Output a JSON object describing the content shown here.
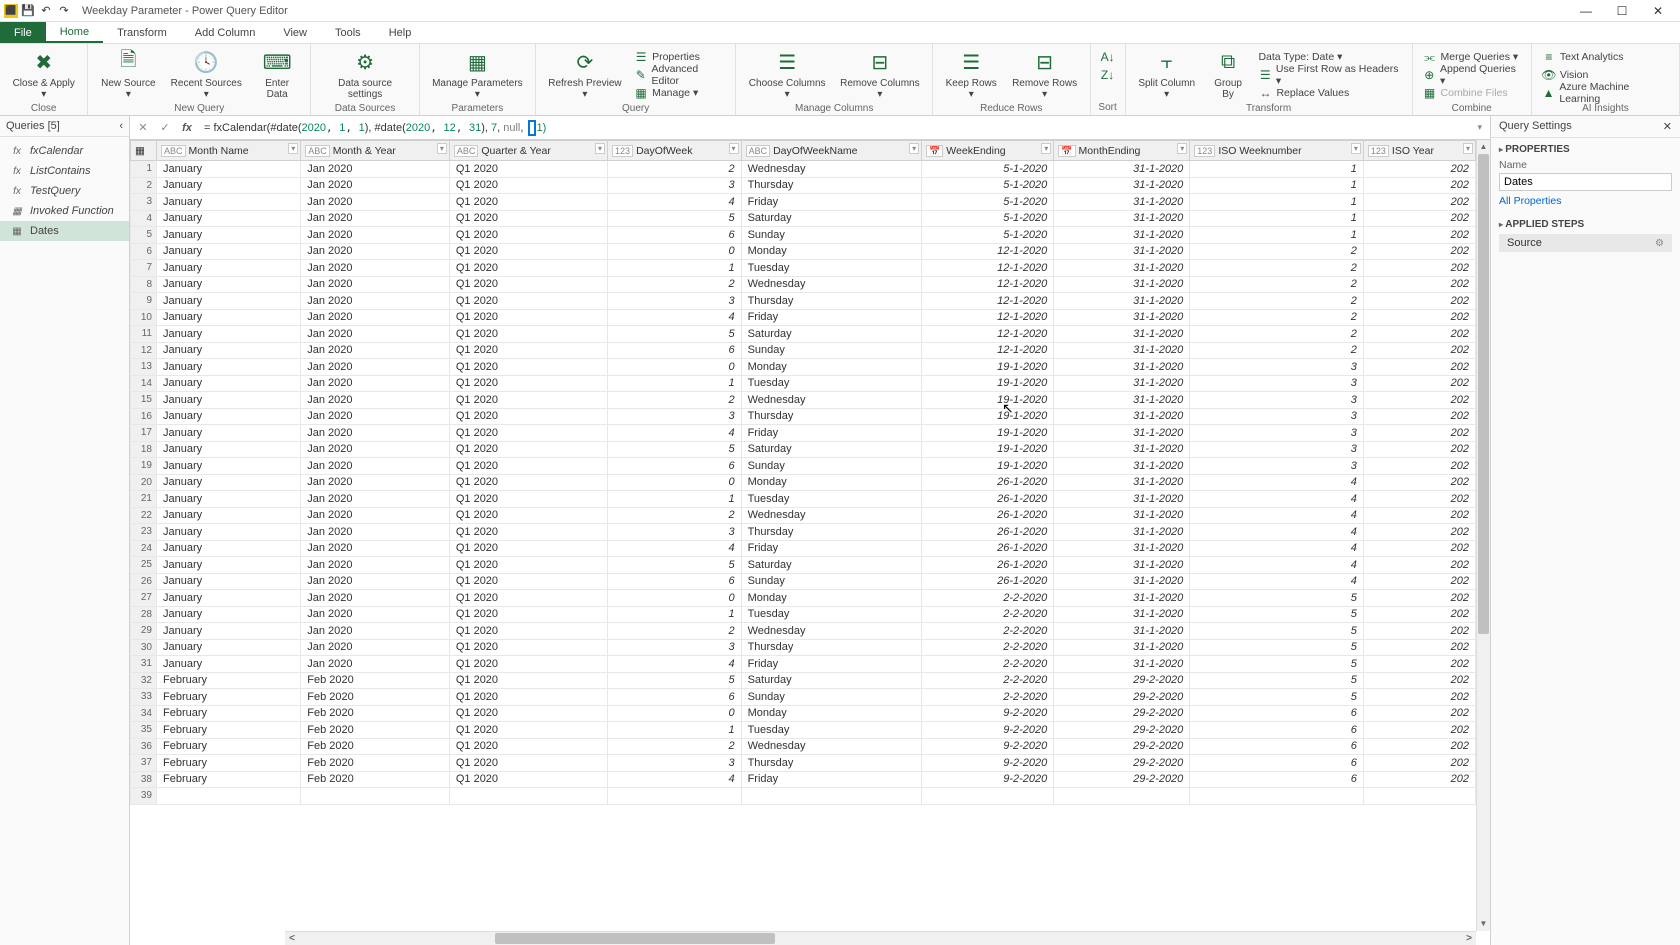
{
  "window": {
    "title": "Weekday Parameter - Power Query Editor",
    "minimize": "—",
    "maximize": "☐",
    "close": "✕"
  },
  "menutabs": {
    "file": "File",
    "home": "Home",
    "transform": "Transform",
    "addcolumn": "Add Column",
    "view": "View",
    "tools": "Tools",
    "help": "Help"
  },
  "ribbon": {
    "close_apply": "Close &\nApply ▾",
    "close_group": "Close",
    "new_source": "New\nSource ▾",
    "recent_sources": "Recent\nSources ▾",
    "enter_data": "Enter\nData",
    "new_query_group": "New Query",
    "data_source_settings": "Data source\nsettings",
    "data_sources_group": "Data Sources",
    "manage_parameters": "Manage\nParameters ▾",
    "parameters_group": "Parameters",
    "refresh_preview": "Refresh\nPreview ▾",
    "properties": "Properties",
    "advanced_editor": "Advanced Editor",
    "manage": "Manage ▾",
    "query_group": "Query",
    "choose_columns": "Choose\nColumns ▾",
    "remove_columns": "Remove\nColumns ▾",
    "manage_columns_group": "Manage Columns",
    "keep_rows": "Keep\nRows ▾",
    "remove_rows": "Remove\nRows ▾",
    "reduce_rows_group": "Reduce Rows",
    "sort_group": "Sort",
    "split_column": "Split\nColumn ▾",
    "group_by": "Group\nBy",
    "data_type": "Data Type: Date ▾",
    "first_row_headers": "Use First Row as Headers ▾",
    "replace_values": "Replace Values",
    "transform_group": "Transform",
    "merge_queries": "Merge Queries ▾",
    "append_queries": "Append Queries ▾",
    "combine_files": "Combine Files",
    "combine_group": "Combine",
    "text_analytics": "Text Analytics",
    "vision": "Vision",
    "azure_ml": "Azure Machine Learning",
    "ai_insights_group": "AI Insights"
  },
  "queries": {
    "header": "Queries [5]",
    "collapse": "‹",
    "items": [
      {
        "name": "fxCalendar",
        "icon": "fx"
      },
      {
        "name": "ListContains",
        "icon": "fx"
      },
      {
        "name": "TestQuery",
        "icon": "fx"
      },
      {
        "name": "Invoked Function",
        "icon": "▦"
      },
      {
        "name": "Dates",
        "icon": "▦"
      }
    ]
  },
  "formula": {
    "prefix": "= fxCalendar(#date(",
    "d1a": "2020",
    "d1b": "1",
    "d1c": "1",
    "mid1": "), #date(",
    "d2a": "2020",
    "d2b": "12",
    "d2c": "31",
    "mid2": "), ",
    "arg3": "7",
    "mid3": ", ",
    "arg4": "null",
    "mid4": ", ",
    "arg5a": " ",
    "arg5b": "1)",
    "fx_label": "fx"
  },
  "columns": [
    {
      "name": "Month Name",
      "type": "ABC"
    },
    {
      "name": "Month & Year",
      "type": "ABC"
    },
    {
      "name": "Quarter & Year",
      "type": "ABC"
    },
    {
      "name": "DayOfWeek",
      "type": "123"
    },
    {
      "name": "DayOfWeekName",
      "type": "ABC"
    },
    {
      "name": "WeekEnding",
      "type": "📅"
    },
    {
      "name": "MonthEnding",
      "type": "📅"
    },
    {
      "name": "ISO Weeknumber",
      "type": "123"
    },
    {
      "name": "ISO Year",
      "type": "123"
    }
  ],
  "rows": [
    {
      "n": 1,
      "mn": "January",
      "my": "Jan 2020",
      "qy": "Q1 2020",
      "dow": 2,
      "down": "Wednesday",
      "we": "5-1-2020",
      "me": "31-1-2020",
      "iw": 1,
      "iy": "202"
    },
    {
      "n": 2,
      "mn": "January",
      "my": "Jan 2020",
      "qy": "Q1 2020",
      "dow": 3,
      "down": "Thursday",
      "we": "5-1-2020",
      "me": "31-1-2020",
      "iw": 1,
      "iy": "202"
    },
    {
      "n": 3,
      "mn": "January",
      "my": "Jan 2020",
      "qy": "Q1 2020",
      "dow": 4,
      "down": "Friday",
      "we": "5-1-2020",
      "me": "31-1-2020",
      "iw": 1,
      "iy": "202"
    },
    {
      "n": 4,
      "mn": "January",
      "my": "Jan 2020",
      "qy": "Q1 2020",
      "dow": 5,
      "down": "Saturday",
      "we": "5-1-2020",
      "me": "31-1-2020",
      "iw": 1,
      "iy": "202"
    },
    {
      "n": 5,
      "mn": "January",
      "my": "Jan 2020",
      "qy": "Q1 2020",
      "dow": 6,
      "down": "Sunday",
      "we": "5-1-2020",
      "me": "31-1-2020",
      "iw": 1,
      "iy": "202"
    },
    {
      "n": 6,
      "mn": "January",
      "my": "Jan 2020",
      "qy": "Q1 2020",
      "dow": 0,
      "down": "Monday",
      "we": "12-1-2020",
      "me": "31-1-2020",
      "iw": 2,
      "iy": "202"
    },
    {
      "n": 7,
      "mn": "January",
      "my": "Jan 2020",
      "qy": "Q1 2020",
      "dow": 1,
      "down": "Tuesday",
      "we": "12-1-2020",
      "me": "31-1-2020",
      "iw": 2,
      "iy": "202"
    },
    {
      "n": 8,
      "mn": "January",
      "my": "Jan 2020",
      "qy": "Q1 2020",
      "dow": 2,
      "down": "Wednesday",
      "we": "12-1-2020",
      "me": "31-1-2020",
      "iw": 2,
      "iy": "202"
    },
    {
      "n": 9,
      "mn": "January",
      "my": "Jan 2020",
      "qy": "Q1 2020",
      "dow": 3,
      "down": "Thursday",
      "we": "12-1-2020",
      "me": "31-1-2020",
      "iw": 2,
      "iy": "202"
    },
    {
      "n": 10,
      "mn": "January",
      "my": "Jan 2020",
      "qy": "Q1 2020",
      "dow": 4,
      "down": "Friday",
      "we": "12-1-2020",
      "me": "31-1-2020",
      "iw": 2,
      "iy": "202"
    },
    {
      "n": 11,
      "mn": "January",
      "my": "Jan 2020",
      "qy": "Q1 2020",
      "dow": 5,
      "down": "Saturday",
      "we": "12-1-2020",
      "me": "31-1-2020",
      "iw": 2,
      "iy": "202"
    },
    {
      "n": 12,
      "mn": "January",
      "my": "Jan 2020",
      "qy": "Q1 2020",
      "dow": 6,
      "down": "Sunday",
      "we": "12-1-2020",
      "me": "31-1-2020",
      "iw": 2,
      "iy": "202"
    },
    {
      "n": 13,
      "mn": "January",
      "my": "Jan 2020",
      "qy": "Q1 2020",
      "dow": 0,
      "down": "Monday",
      "we": "19-1-2020",
      "me": "31-1-2020",
      "iw": 3,
      "iy": "202"
    },
    {
      "n": 14,
      "mn": "January",
      "my": "Jan 2020",
      "qy": "Q1 2020",
      "dow": 1,
      "down": "Tuesday",
      "we": "19-1-2020",
      "me": "31-1-2020",
      "iw": 3,
      "iy": "202"
    },
    {
      "n": 15,
      "mn": "January",
      "my": "Jan 2020",
      "qy": "Q1 2020",
      "dow": 2,
      "down": "Wednesday",
      "we": "19-1-2020",
      "me": "31-1-2020",
      "iw": 3,
      "iy": "202"
    },
    {
      "n": 16,
      "mn": "January",
      "my": "Jan 2020",
      "qy": "Q1 2020",
      "dow": 3,
      "down": "Thursday",
      "we": "19-1-2020",
      "me": "31-1-2020",
      "iw": 3,
      "iy": "202"
    },
    {
      "n": 17,
      "mn": "January",
      "my": "Jan 2020",
      "qy": "Q1 2020",
      "dow": 4,
      "down": "Friday",
      "we": "19-1-2020",
      "me": "31-1-2020",
      "iw": 3,
      "iy": "202"
    },
    {
      "n": 18,
      "mn": "January",
      "my": "Jan 2020",
      "qy": "Q1 2020",
      "dow": 5,
      "down": "Saturday",
      "we": "19-1-2020",
      "me": "31-1-2020",
      "iw": 3,
      "iy": "202"
    },
    {
      "n": 19,
      "mn": "January",
      "my": "Jan 2020",
      "qy": "Q1 2020",
      "dow": 6,
      "down": "Sunday",
      "we": "19-1-2020",
      "me": "31-1-2020",
      "iw": 3,
      "iy": "202"
    },
    {
      "n": 20,
      "mn": "January",
      "my": "Jan 2020",
      "qy": "Q1 2020",
      "dow": 0,
      "down": "Monday",
      "we": "26-1-2020",
      "me": "31-1-2020",
      "iw": 4,
      "iy": "202"
    },
    {
      "n": 21,
      "mn": "January",
      "my": "Jan 2020",
      "qy": "Q1 2020",
      "dow": 1,
      "down": "Tuesday",
      "we": "26-1-2020",
      "me": "31-1-2020",
      "iw": 4,
      "iy": "202"
    },
    {
      "n": 22,
      "mn": "January",
      "my": "Jan 2020",
      "qy": "Q1 2020",
      "dow": 2,
      "down": "Wednesday",
      "we": "26-1-2020",
      "me": "31-1-2020",
      "iw": 4,
      "iy": "202"
    },
    {
      "n": 23,
      "mn": "January",
      "my": "Jan 2020",
      "qy": "Q1 2020",
      "dow": 3,
      "down": "Thursday",
      "we": "26-1-2020",
      "me": "31-1-2020",
      "iw": 4,
      "iy": "202"
    },
    {
      "n": 24,
      "mn": "January",
      "my": "Jan 2020",
      "qy": "Q1 2020",
      "dow": 4,
      "down": "Friday",
      "we": "26-1-2020",
      "me": "31-1-2020",
      "iw": 4,
      "iy": "202"
    },
    {
      "n": 25,
      "mn": "January",
      "my": "Jan 2020",
      "qy": "Q1 2020",
      "dow": 5,
      "down": "Saturday",
      "we": "26-1-2020",
      "me": "31-1-2020",
      "iw": 4,
      "iy": "202"
    },
    {
      "n": 26,
      "mn": "January",
      "my": "Jan 2020",
      "qy": "Q1 2020",
      "dow": 6,
      "down": "Sunday",
      "we": "26-1-2020",
      "me": "31-1-2020",
      "iw": 4,
      "iy": "202"
    },
    {
      "n": 27,
      "mn": "January",
      "my": "Jan 2020",
      "qy": "Q1 2020",
      "dow": 0,
      "down": "Monday",
      "we": "2-2-2020",
      "me": "31-1-2020",
      "iw": 5,
      "iy": "202"
    },
    {
      "n": 28,
      "mn": "January",
      "my": "Jan 2020",
      "qy": "Q1 2020",
      "dow": 1,
      "down": "Tuesday",
      "we": "2-2-2020",
      "me": "31-1-2020",
      "iw": 5,
      "iy": "202"
    },
    {
      "n": 29,
      "mn": "January",
      "my": "Jan 2020",
      "qy": "Q1 2020",
      "dow": 2,
      "down": "Wednesday",
      "we": "2-2-2020",
      "me": "31-1-2020",
      "iw": 5,
      "iy": "202"
    },
    {
      "n": 30,
      "mn": "January",
      "my": "Jan 2020",
      "qy": "Q1 2020",
      "dow": 3,
      "down": "Thursday",
      "we": "2-2-2020",
      "me": "31-1-2020",
      "iw": 5,
      "iy": "202"
    },
    {
      "n": 31,
      "mn": "January",
      "my": "Jan 2020",
      "qy": "Q1 2020",
      "dow": 4,
      "down": "Friday",
      "we": "2-2-2020",
      "me": "31-1-2020",
      "iw": 5,
      "iy": "202"
    },
    {
      "n": 32,
      "mn": "February",
      "my": "Feb 2020",
      "qy": "Q1 2020",
      "dow": 5,
      "down": "Saturday",
      "we": "2-2-2020",
      "me": "29-2-2020",
      "iw": 5,
      "iy": "202"
    },
    {
      "n": 33,
      "mn": "February",
      "my": "Feb 2020",
      "qy": "Q1 2020",
      "dow": 6,
      "down": "Sunday",
      "we": "2-2-2020",
      "me": "29-2-2020",
      "iw": 5,
      "iy": "202"
    },
    {
      "n": 34,
      "mn": "February",
      "my": "Feb 2020",
      "qy": "Q1 2020",
      "dow": 0,
      "down": "Monday",
      "we": "9-2-2020",
      "me": "29-2-2020",
      "iw": 6,
      "iy": "202"
    },
    {
      "n": 35,
      "mn": "February",
      "my": "Feb 2020",
      "qy": "Q1 2020",
      "dow": 1,
      "down": "Tuesday",
      "we": "9-2-2020",
      "me": "29-2-2020",
      "iw": 6,
      "iy": "202"
    },
    {
      "n": 36,
      "mn": "February",
      "my": "Feb 2020",
      "qy": "Q1 2020",
      "dow": 2,
      "down": "Wednesday",
      "we": "9-2-2020",
      "me": "29-2-2020",
      "iw": 6,
      "iy": "202"
    },
    {
      "n": 37,
      "mn": "February",
      "my": "Feb 2020",
      "qy": "Q1 2020",
      "dow": 3,
      "down": "Thursday",
      "we": "9-2-2020",
      "me": "29-2-2020",
      "iw": 6,
      "iy": "202"
    },
    {
      "n": 38,
      "mn": "February",
      "my": "Feb 2020",
      "qy": "Q1 2020",
      "dow": 4,
      "down": "Friday",
      "we": "9-2-2020",
      "me": "29-2-2020",
      "iw": 6,
      "iy": "202"
    },
    {
      "n": 39,
      "mn": "",
      "my": "",
      "qy": "",
      "dow": "",
      "down": "",
      "we": "",
      "me": "",
      "iw": "",
      "iy": ""
    }
  ],
  "settings": {
    "header": "Query Settings",
    "close": "✕",
    "properties_label": "PROPERTIES",
    "name_label": "Name",
    "name_value": "Dates",
    "all_properties": "All Properties",
    "applied_steps_label": "APPLIED STEPS",
    "steps": [
      {
        "name": "Source"
      }
    ]
  }
}
